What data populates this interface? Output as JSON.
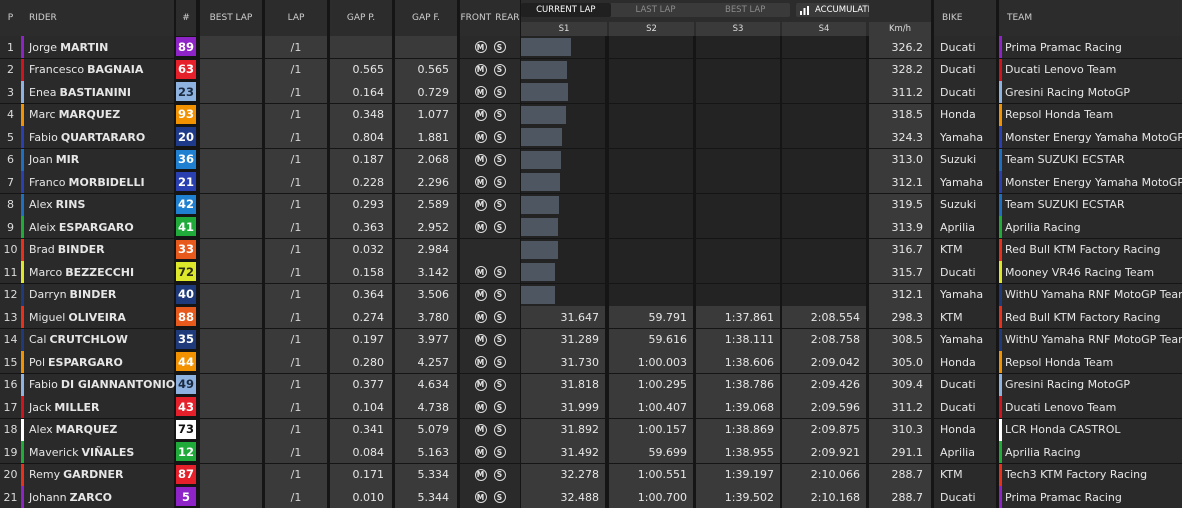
{
  "header": {
    "p": "P",
    "rider": "RIDER",
    "num": "#",
    "best_lap": "BEST LAP",
    "lap": "LAP",
    "gap_p": "GAP P.",
    "gap_f": "GAP F.",
    "front": "FRONT",
    "rear": "REAR",
    "view_tabs": [
      "CURRENT LAP",
      "LAST LAP",
      "BEST LAP"
    ],
    "active_tab": 0,
    "mode_select": "ACCUMULATED",
    "sectors": [
      "S1",
      "S2",
      "S3",
      "S4"
    ],
    "speed_unit": "Km/h",
    "bike": "BIKE",
    "team": "TEAM"
  },
  "tyre_front_icon": "M",
  "tyre_rear_icon": "S",
  "rows": [
    {
      "pos": "1",
      "first": "Jorge",
      "last": "MARTIN",
      "num": "89",
      "num_color": "#8e24c8",
      "num_text": "#ffffff",
      "team_color": "#8e24c8",
      "lap": "/1",
      "gap_p": "",
      "gap_f": "",
      "tyres": true,
      "bar_fraction": 0.58,
      "s1": "",
      "s2": "",
      "s3": "",
      "s4": "",
      "speed": "326.2",
      "bike": "Ducati",
      "team": "Prima Pramac Racing"
    },
    {
      "pos": "2",
      "first": "Francesco",
      "last": "BAGNAIA",
      "num": "63",
      "num_color": "#e5202a",
      "num_text": "#ffffff",
      "team_color": "#d0141e",
      "lap": "/1",
      "gap_p": "0.565",
      "gap_f": "0.565",
      "tyres": true,
      "bar_fraction": 0.53,
      "s1": "",
      "s2": "",
      "s3": "",
      "s4": "",
      "speed": "328.2",
      "bike": "Ducati",
      "team": "Ducati Lenovo Team"
    },
    {
      "pos": "3",
      "first": "Enea",
      "last": "BASTIANINI",
      "num": "23",
      "num_color": "#8fb3e0",
      "num_text": "#1a2a40",
      "team_color": "#8fb3e0",
      "lap": "/1",
      "gap_p": "0.164",
      "gap_f": "0.729",
      "tyres": true,
      "bar_fraction": 0.55,
      "s1": "",
      "s2": "",
      "s3": "",
      "s4": "",
      "speed": "311.2",
      "bike": "Ducati",
      "team": "Gresini Racing MotoGP"
    },
    {
      "pos": "4",
      "first": "Marc",
      "last": "MARQUEZ",
      "num": "93",
      "num_color": "#f39200",
      "num_text": "#ffffff",
      "team_color": "#f39200",
      "lap": "/1",
      "gap_p": "0.348",
      "gap_f": "1.077",
      "tyres": true,
      "bar_fraction": 0.52,
      "s1": "",
      "s2": "",
      "s3": "",
      "s4": "",
      "speed": "318.5",
      "bike": "Honda",
      "team": "Repsol Honda Team"
    },
    {
      "pos": "5",
      "first": "Fabio",
      "last": "QUARTARARO",
      "num": "20",
      "num_color": "#1e3a8a",
      "num_text": "#ffffff",
      "team_color": "#2a3fb0",
      "lap": "/1",
      "gap_p": "0.804",
      "gap_f": "1.881",
      "tyres": true,
      "bar_fraction": 0.48,
      "s1": "",
      "s2": "",
      "s3": "",
      "s4": "",
      "speed": "324.3",
      "bike": "Yamaha",
      "team": "Monster Energy Yamaha MotoGP"
    },
    {
      "pos": "6",
      "first": "Joan",
      "last": "MIR",
      "num": "36",
      "num_color": "#1f7fd0",
      "num_text": "#ffffff",
      "team_color": "#1f6fc0",
      "lap": "/1",
      "gap_p": "0.187",
      "gap_f": "2.068",
      "tyres": true,
      "bar_fraction": 0.47,
      "s1": "",
      "s2": "",
      "s3": "",
      "s4": "",
      "speed": "313.0",
      "bike": "Suzuki",
      "team": "Team SUZUKI ECSTAR"
    },
    {
      "pos": "7",
      "first": "Franco",
      "last": "MORBIDELLI",
      "num": "21",
      "num_color": "#2a3fb0",
      "num_text": "#ffffff",
      "team_color": "#2a3fb0",
      "lap": "/1",
      "gap_p": "0.228",
      "gap_f": "2.296",
      "tyres": true,
      "bar_fraction": 0.45,
      "s1": "",
      "s2": "",
      "s3": "",
      "s4": "",
      "speed": "312.1",
      "bike": "Yamaha",
      "team": "Monster Energy Yamaha MotoGP"
    },
    {
      "pos": "8",
      "first": "Alex",
      "last": "RINS",
      "num": "42",
      "num_color": "#1f7fd0",
      "num_text": "#ffffff",
      "team_color": "#1f6fc0",
      "lap": "/1",
      "gap_p": "0.293",
      "gap_f": "2.589",
      "tyres": true,
      "bar_fraction": 0.44,
      "s1": "",
      "s2": "",
      "s3": "",
      "s4": "",
      "speed": "319.5",
      "bike": "Suzuki",
      "team": "Team SUZUKI ECSTAR"
    },
    {
      "pos": "9",
      "first": "Aleix",
      "last": "ESPARGARO",
      "num": "41",
      "num_color": "#1faa3a",
      "num_text": "#ffffff",
      "team_color": "#1faa3a",
      "lap": "/1",
      "gap_p": "0.363",
      "gap_f": "2.952",
      "tyres": true,
      "bar_fraction": 0.43,
      "s1": "",
      "s2": "",
      "s3": "",
      "s4": "",
      "speed": "313.9",
      "bike": "Aprilia",
      "team": "Aprilia Racing"
    },
    {
      "pos": "10",
      "first": "Brad",
      "last": "BINDER",
      "num": "33",
      "num_color": "#e85a1c",
      "num_text": "#ffffff",
      "team_color": "#e8301c",
      "lap": "/1",
      "gap_p": "0.032",
      "gap_f": "2.984",
      "tyres": false,
      "bar_fraction": 0.43,
      "s1": "",
      "s2": "",
      "s3": "",
      "s4": "",
      "speed": "316.7",
      "bike": "KTM",
      "team": "Red Bull KTM Factory Racing"
    },
    {
      "pos": "11",
      "first": "Marco",
      "last": "BEZZECCHI",
      "num": "72",
      "num_color": "#dde82a",
      "num_text": "#2a2a10",
      "team_color": "#dde82a",
      "lap": "/1",
      "gap_p": "0.158",
      "gap_f": "3.142",
      "tyres": true,
      "bar_fraction": 0.4,
      "s1": "",
      "s2": "",
      "s3": "",
      "s4": "",
      "speed": "315.7",
      "bike": "Ducati",
      "team": "Mooney VR46 Racing Team"
    },
    {
      "pos": "12",
      "first": "Darryn",
      "last": "BINDER",
      "num": "40",
      "num_color": "#1e3a7a",
      "num_text": "#ffffff",
      "team_color": "#1e3a7a",
      "lap": "/1",
      "gap_p": "0.364",
      "gap_f": "3.506",
      "tyres": true,
      "bar_fraction": 0.4,
      "s1": "",
      "s2": "",
      "s3": "",
      "s4": "",
      "speed": "312.1",
      "bike": "Yamaha",
      "team": "WithU Yamaha RNF MotoGP Team"
    },
    {
      "pos": "13",
      "first": "Miguel",
      "last": "OLIVEIRA",
      "num": "88",
      "num_color": "#e85a1c",
      "num_text": "#ffffff",
      "team_color": "#e8301c",
      "lap": "/1",
      "gap_p": "0.274",
      "gap_f": "3.780",
      "tyres": true,
      "bar_fraction": 0,
      "s1": "31.647",
      "s2": "59.791",
      "s3": "1:37.861",
      "s4": "2:08.554",
      "speed": "298.3",
      "bike": "KTM",
      "team": "Red Bull KTM Factory Racing"
    },
    {
      "pos": "14",
      "first": "Cal",
      "last": "CRUTCHLOW",
      "num": "35",
      "num_color": "#1e3a7a",
      "num_text": "#ffffff",
      "team_color": "#1e3a7a",
      "lap": "/1",
      "gap_p": "0.197",
      "gap_f": "3.977",
      "tyres": true,
      "bar_fraction": 0,
      "s1": "31.289",
      "s2": "59.616",
      "s3": "1:38.111",
      "s4": "2:08.758",
      "speed": "308.5",
      "bike": "Yamaha",
      "team": "WithU Yamaha RNF MotoGP Team"
    },
    {
      "pos": "15",
      "first": "Pol",
      "last": "ESPARGARO",
      "num": "44",
      "num_color": "#f39200",
      "num_text": "#ffffff",
      "team_color": "#f39200",
      "lap": "/1",
      "gap_p": "0.280",
      "gap_f": "4.257",
      "tyres": true,
      "bar_fraction": 0,
      "s1": "31.730",
      "s2": "1:00.003",
      "s3": "1:38.606",
      "s4": "2:09.042",
      "speed": "305.0",
      "bike": "Honda",
      "team": "Repsol Honda Team"
    },
    {
      "pos": "16",
      "first": "Fabio",
      "last": "DI GIANNANTONIO",
      "num": "49",
      "num_color": "#8fb3e0",
      "num_text": "#1a2a40",
      "team_color": "#8fb3e0",
      "lap": "/1",
      "gap_p": "0.377",
      "gap_f": "4.634",
      "tyres": true,
      "bar_fraction": 0,
      "s1": "31.818",
      "s2": "1:00.295",
      "s3": "1:38.786",
      "s4": "2:09.426",
      "speed": "309.4",
      "bike": "Ducati",
      "team": "Gresini Racing MotoGP"
    },
    {
      "pos": "17",
      "first": "Jack",
      "last": "MILLER",
      "num": "43",
      "num_color": "#e5202a",
      "num_text": "#ffffff",
      "team_color": "#d0141e",
      "lap": "/1",
      "gap_p": "0.104",
      "gap_f": "4.738",
      "tyres": true,
      "bar_fraction": 0,
      "s1": "31.999",
      "s2": "1:00.407",
      "s3": "1:39.068",
      "s4": "2:09.596",
      "speed": "311.2",
      "bike": "Ducati",
      "team": "Ducati Lenovo Team"
    },
    {
      "pos": "18",
      "first": "Alex",
      "last": "MARQUEZ",
      "num": "73",
      "num_color": "#ffffff",
      "num_text": "#111111",
      "team_color": "#ffffff",
      "lap": "/1",
      "gap_p": "0.341",
      "gap_f": "5.079",
      "tyres": true,
      "bar_fraction": 0,
      "s1": "31.892",
      "s2": "1:00.157",
      "s3": "1:38.869",
      "s4": "2:09.875",
      "speed": "310.3",
      "bike": "Honda",
      "team": "LCR Honda CASTROL"
    },
    {
      "pos": "19",
      "first": "Maverick",
      "last": "VIÑALES",
      "num": "12",
      "num_color": "#1faa3a",
      "num_text": "#ffffff",
      "team_color": "#1faa3a",
      "lap": "/1",
      "gap_p": "0.084",
      "gap_f": "5.163",
      "tyres": true,
      "bar_fraction": 0,
      "s1": "31.492",
      "s2": "59.699",
      "s3": "1:38.955",
      "s4": "2:09.921",
      "speed": "291.1",
      "bike": "Aprilia",
      "team": "Aprilia Racing"
    },
    {
      "pos": "20",
      "first": "Remy",
      "last": "GARDNER",
      "num": "87",
      "num_color": "#e5202a",
      "num_text": "#ffffff",
      "team_color": "#e8301c",
      "lap": "/1",
      "gap_p": "0.171",
      "gap_f": "5.334",
      "tyres": true,
      "bar_fraction": 0,
      "s1": "32.278",
      "s2": "1:00.551",
      "s3": "1:39.197",
      "s4": "2:10.066",
      "speed": "288.7",
      "bike": "KTM",
      "team": "Tech3 KTM Factory Racing"
    },
    {
      "pos": "21",
      "first": "Johann",
      "last": "ZARCO",
      "num": "5",
      "num_color": "#8e24c8",
      "num_text": "#ffffff",
      "team_color": "#8e24c8",
      "lap": "/1",
      "gap_p": "0.010",
      "gap_f": "5.344",
      "tyres": true,
      "bar_fraction": 0,
      "s1": "32.488",
      "s2": "1:00.700",
      "s3": "1:39.502",
      "s4": "2:10.168",
      "speed": "288.7",
      "bike": "Ducati",
      "team": "Prima Pramac Racing"
    }
  ]
}
